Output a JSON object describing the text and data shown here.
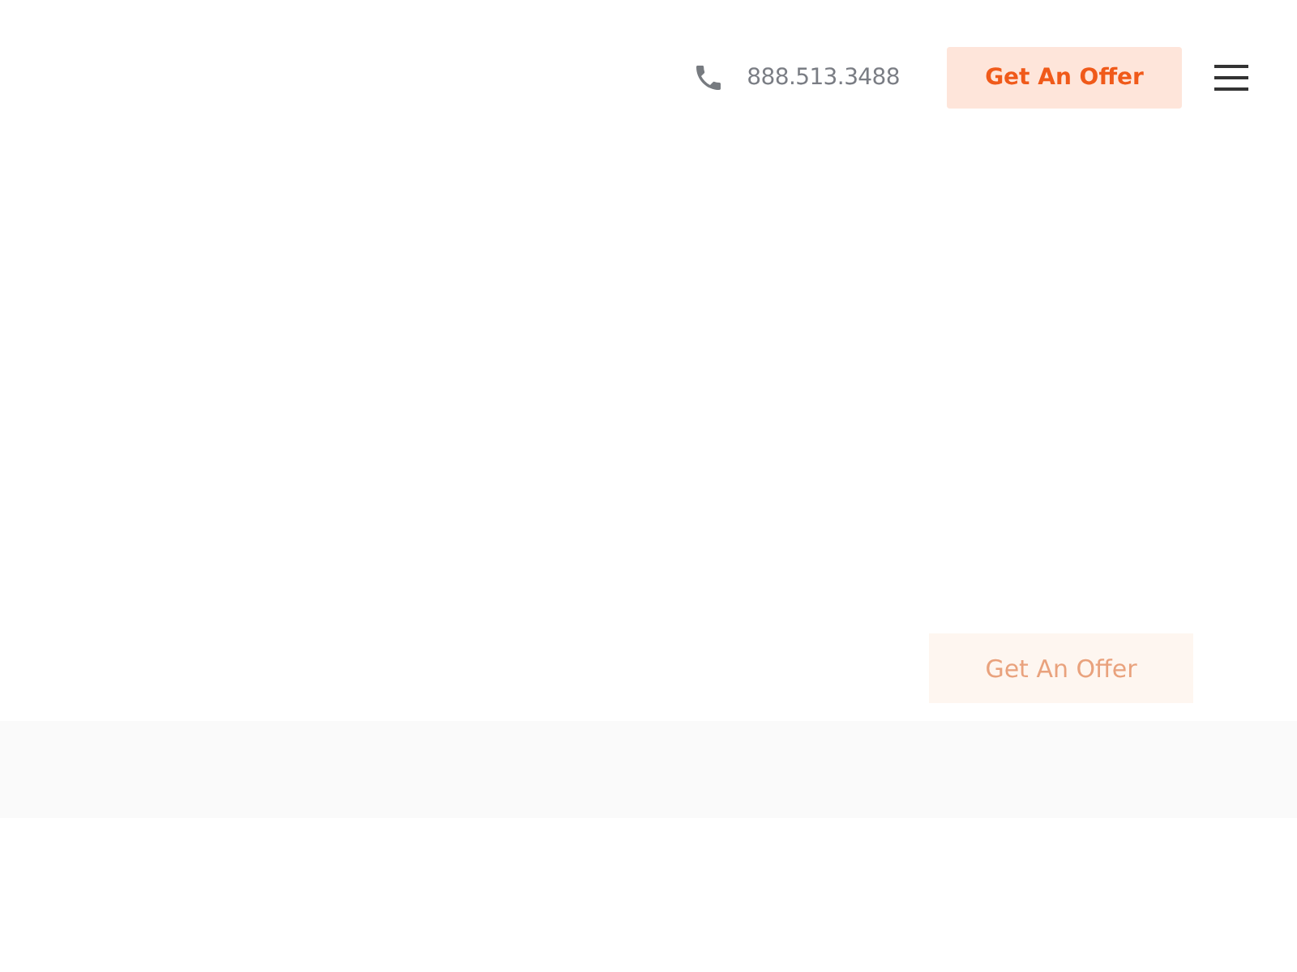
{
  "header": {
    "phone": "888.513.3488",
    "cta": "Get An Offer"
  },
  "hero": {
    "button": "Get An Offer"
  }
}
